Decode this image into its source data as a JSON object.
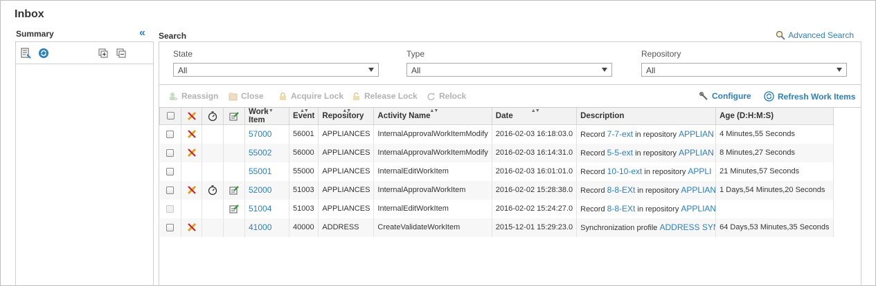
{
  "page": {
    "title": "Inbox"
  },
  "summary": {
    "label": "Summary"
  },
  "search": {
    "label": "Search",
    "advanced_label": "Advanced Search",
    "filters": [
      {
        "label": "State",
        "value": "All"
      },
      {
        "label": "Type",
        "value": "All"
      },
      {
        "label": "Repository",
        "value": "All"
      }
    ]
  },
  "actions": {
    "reassign": "Reassign",
    "close": "Close",
    "acquire_lock": "Acquire Lock",
    "release_lock": "Release Lock",
    "relock": "Relock",
    "configure": "Configure",
    "refresh": "Refresh Work Items"
  },
  "table": {
    "columns": [
      "Work Item",
      "Event",
      "Repository",
      "Activity Name",
      "Date",
      "Description",
      "Age (D:H:M:S)"
    ],
    "rows": [
      {
        "work_item": "57000",
        "event": "56001",
        "repository": "APPLIANCES",
        "activity": "InternalApprovalWorkItemModify",
        "date": "2016-02-03 16:18:03.0",
        "desc_prefix": "Record",
        "desc_link": "7-7-ext",
        "desc_mid": "in repository",
        "desc_link2": "APPLIAN",
        "age": "4 Minutes,55 Seconds",
        "icons": {
          "cross": true,
          "timer": false,
          "edit": false
        },
        "disabled": false
      },
      {
        "work_item": "55002",
        "event": "56000",
        "repository": "APPLIANCES",
        "activity": "InternalApprovalWorkItemModify",
        "date": "2016-02-03 16:14:31.0",
        "desc_prefix": "Record",
        "desc_link": "5-5-ext",
        "desc_mid": "in repository",
        "desc_link2": "APPLIAN",
        "age": "8 Minutes,27 Seconds",
        "icons": {
          "cross": true,
          "timer": false,
          "edit": false
        },
        "disabled": false
      },
      {
        "work_item": "55001",
        "event": "55000",
        "repository": "APPLIANCES",
        "activity": "InternalEditWorkItem",
        "date": "2016-02-03 16:01:01.0",
        "desc_prefix": "Record",
        "desc_link": "10-10-ext",
        "desc_mid": "in repository",
        "desc_link2": "APPLI",
        "age": "21 Minutes,57 Seconds",
        "icons": {
          "cross": false,
          "timer": false,
          "edit": false
        },
        "disabled": false
      },
      {
        "work_item": "52000",
        "event": "51003",
        "repository": "APPLIANCES",
        "activity": "InternalApprovalWorkItem",
        "date": "2016-02-02 15:28:38.0",
        "desc_prefix": "Record",
        "desc_link": "8-8-EXt",
        "desc_mid": "in repository",
        "desc_link2": "APPLIAN",
        "age": "1 Days,54 Minutes,20 Seconds",
        "icons": {
          "cross": true,
          "timer": true,
          "edit": true
        },
        "disabled": false
      },
      {
        "work_item": "51004",
        "event": "51003",
        "repository": "APPLIANCES",
        "activity": "InternalEditWorkItem",
        "date": "2016-02-02 15:24:27.0",
        "desc_prefix": "Record",
        "desc_link": "8-8-EXt",
        "desc_mid": "in repository",
        "desc_link2": "APPLIAN",
        "age": "",
        "icons": {
          "cross": false,
          "timer": false,
          "edit": true
        },
        "disabled": true
      },
      {
        "work_item": "41000",
        "event": "40000",
        "repository": "ADDRESS",
        "activity": "CreateValidateWorkItem",
        "date": "2015-12-01 15:29:23.0",
        "desc_prefix": "Synchronization profile",
        "desc_link": "ADDRESS SYN",
        "desc_mid": "",
        "desc_link2": "",
        "age": "64 Days,53 Minutes,35 Seconds",
        "icons": {
          "cross": true,
          "timer": false,
          "edit": false
        },
        "disabled": false
      }
    ]
  }
}
